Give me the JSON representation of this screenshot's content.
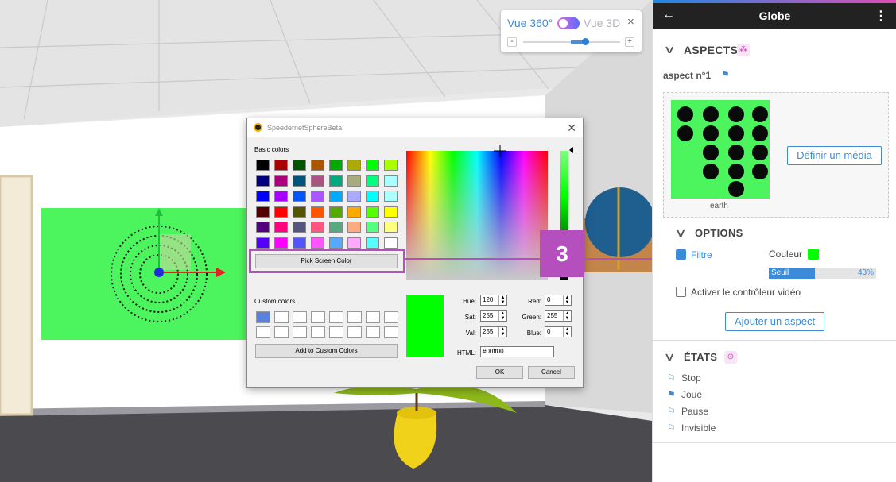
{
  "view_toggle": {
    "label_360": "Vue 360°",
    "label_3d": "Vue 3D",
    "close": "×",
    "zoom_out": "-",
    "zoom_in": "+"
  },
  "dialog": {
    "title": "SpeedernetSphereBeta",
    "close": "✕",
    "basic_colors_label": "Basic colors",
    "custom_colors_label": "Custom colors",
    "pick_screen_color": "Pick Screen Color",
    "add_custom": "Add to Custom Colors",
    "ok": "OK",
    "cancel": "Cancel",
    "fields": {
      "hue_label": "Hue:",
      "hue": "120",
      "sat_label": "Sat:",
      "sat": "255",
      "val_label": "Val:",
      "val": "255",
      "red_label": "Red:",
      "red": "0",
      "green_label": "Green:",
      "green": "255",
      "blue_label": "Blue:",
      "blue": "0",
      "html_label": "HTML:",
      "html": "#00ff00"
    },
    "basic_colors": [
      "#000000",
      "#aa0000",
      "#005500",
      "#aa5500",
      "#00aa00",
      "#aaaa00",
      "#00ff00",
      "#aaff00",
      "#00007f",
      "#aa007f",
      "#00557f",
      "#aa557f",
      "#00aa7f",
      "#aaaa7f",
      "#00ff7f",
      "#aaffff",
      "#0000ff",
      "#aa00ff",
      "#0055ff",
      "#aa55ff",
      "#00aaff",
      "#aaaaff",
      "#00ffff",
      "#aaffff",
      "#550000",
      "#ff0000",
      "#555500",
      "#ff5500",
      "#55aa00",
      "#ffaa00",
      "#55ff00",
      "#ffff00",
      "#55007f",
      "#ff007f",
      "#55557f",
      "#ff557f",
      "#55aa7f",
      "#ffaa7f",
      "#55ff7f",
      "#ffff7f",
      "#5500ff",
      "#ff00ff",
      "#5555ff",
      "#ff55ff",
      "#55aaff",
      "#ffaaff",
      "#55ffff",
      "#ffffff"
    ],
    "selected_color": "#00ff00"
  },
  "callout": {
    "step": "3",
    "color": "#b54fbd"
  },
  "panel": {
    "title": "Globe",
    "back": "←",
    "menu": "⋮",
    "aspects_title": "ASPECTS",
    "aspect_name": "aspect n°1",
    "media_caption": "earth",
    "define_media": "Définir un média",
    "options_title": "OPTIONS",
    "filter_label": "Filtre",
    "color_label": "Couleur",
    "color_value": "#00ff00",
    "threshold_label": "Seuil",
    "threshold_value": "43%",
    "threshold_fraction": 0.43,
    "video_controller_label": "Activer le contrôleur vidéo",
    "add_aspect": "Ajouter un aspect",
    "states_title": "ÉTATS",
    "states": [
      {
        "label": "Stop",
        "filled": false
      },
      {
        "label": "Joue",
        "filled": true
      },
      {
        "label": "Pause",
        "filled": false
      },
      {
        "label": "Invisible",
        "filled": false
      }
    ]
  }
}
